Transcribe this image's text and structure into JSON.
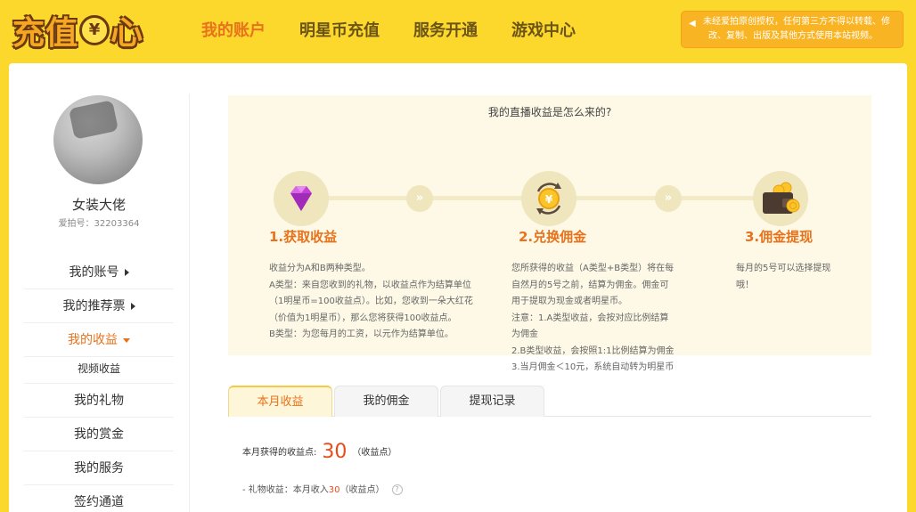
{
  "header": {
    "logo_part1": "充值",
    "logo_coin": "¥",
    "logo_part2": "心",
    "nav": [
      {
        "label": "我的账户"
      },
      {
        "label": "明星币充值"
      },
      {
        "label": "服务开通"
      },
      {
        "label": "游戏中心"
      }
    ],
    "notice_line1": "未经爱拍原创授权，任何第三方不得以转载、修",
    "notice_line2": "改、复制、出版及其他方式使用本站视频。"
  },
  "sidebar": {
    "username": "女装大佬",
    "user_id_label": "爱拍号：32203364",
    "menu": [
      {
        "label": "我的账号"
      },
      {
        "label": "我的推荐票"
      },
      {
        "label": "我的收益"
      },
      {
        "label": "视频收益"
      },
      {
        "label": "我的礼物"
      },
      {
        "label": "我的赏金"
      },
      {
        "label": "我的服务"
      },
      {
        "label": "签约通道"
      }
    ]
  },
  "info": {
    "title": "我的直播收益是怎么来的?",
    "steps": [
      {
        "title": "1.获取收益",
        "lines": [
          "收益分为A和B两种类型。",
          "A类型：来自您收到的礼物，以收益点作为结算单位",
          "（1明星币=100收益点）。比如，您收到一朵大红花",
          "（价值为1明星币），那么您将获得100收益点。",
          "B类型：为您每月的工资，以元作为结算单位。"
        ]
      },
      {
        "title": "2.兑换佣金",
        "lines": [
          "您所获得的收益（A类型+B类型）将在每",
          "自然月的5号之前，结算为佣金。佣金可",
          "用于提取为现金或者明星币。",
          "注意：1.A类型收益，会按对应比例结算",
          "为佣金",
          "2.B类型收益，会按照1:1比例结算为佣金",
          "3.当月佣金＜10元，系统自动转为明星币"
        ]
      },
      {
        "title": "3.佣金提现",
        "lines": [
          "每月的5号可以选择提现",
          "哦！"
        ]
      }
    ]
  },
  "tabs": [
    {
      "label": "本月收益"
    },
    {
      "label": "我的佣金"
    },
    {
      "label": "提现记录"
    }
  ],
  "earnings": {
    "label": "本月获得的收益点:",
    "value": "30",
    "unit": "（收益点）",
    "gift_prefix": "- 礼物收益：本月收入",
    "gift_value": "30",
    "gift_unit": "（收益点）",
    "help_icon_text": "?"
  },
  "colors": {
    "background": "#fcd72c",
    "accent": "#e8721c",
    "highlight_number": "#e84c1e",
    "notice_bg": "#f9b423"
  },
  "icons": [
    "diamond-icon",
    "exchange-coin-icon",
    "wallet-icon",
    "chevron-double-right-icon",
    "caret-right-icon",
    "caret-down-icon",
    "speaker-icon",
    "question-icon"
  ]
}
